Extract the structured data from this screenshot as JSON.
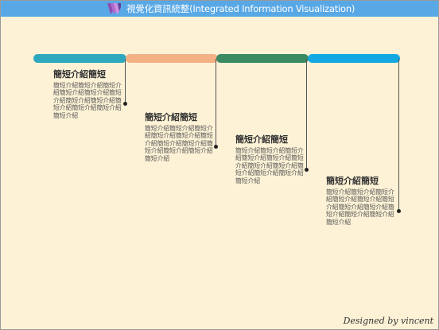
{
  "header": {
    "title": "視覺化資訊統整(Integrated Information Visualization)",
    "logo_icon": "stacked-w-logo-icon",
    "background": "#59a8e6"
  },
  "timeline": {
    "bar_colors": [
      "#2ea8bf",
      "#f4b183",
      "#3a8a64",
      "#13a8e2"
    ],
    "items": [
      {
        "title": "簡短介紹簡短",
        "body": "簡短介紹簡短介紹簡短介紹簡短介紹簡短介紹簡短介紹簡短介紹簡短介紹簡短介紹簡短介紹簡短介紹簡短介紹"
      },
      {
        "title": "簡短介紹簡短",
        "body": "簡短介紹簡短介紹簡短介紹簡短介紹簡短介紹簡短介紹簡短介紹簡短介紹簡短介紹簡短介紹簡短介紹簡短介紹"
      },
      {
        "title": "簡短介紹簡短",
        "body": "簡短介紹簡短介紹簡短介紹簡短介紹簡短介紹簡短介紹簡短介紹簡短介紹簡短介紹簡短介紹簡短介紹簡短介紹"
      },
      {
        "title": "簡短介紹簡短",
        "body": "簡短介紹簡短介紹簡短介紹簡短介紹簡短介紹簡短介紹簡短介紹簡短介紹簡短介紹簡短介紹簡短介紹簡短介紹"
      }
    ]
  },
  "footer": {
    "credit": "Designed by vincent"
  },
  "colors": {
    "background": "#fdf2d6"
  }
}
